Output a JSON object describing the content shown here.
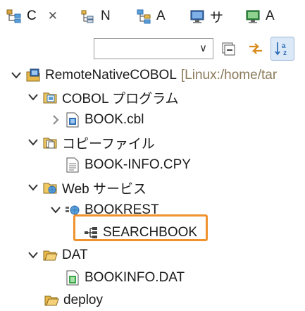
{
  "tabs": [
    {
      "label": "C",
      "icon": "cobol-explorer-icon",
      "active": true,
      "close": "✕"
    },
    {
      "label": "N",
      "icon": "navigator-icon",
      "active": false
    },
    {
      "label": "A",
      "icon": "hierarchy-icon",
      "active": false
    },
    {
      "label": "サ",
      "icon": "monitor-icon",
      "active": false
    },
    {
      "label": "A",
      "icon": "terminal-monitor-icon",
      "active": false
    }
  ],
  "toolbar": {
    "filter_value": "",
    "combo_arrow": "∨",
    "collapse_all": "collapse-all-icon",
    "link_with_editor": "link-editor-icon",
    "sort": "sort-az-icon",
    "sort_label": "↓a z"
  },
  "tree": {
    "project": {
      "label": "RemoteNativeCOBOL",
      "detail": "[Linux:/home/tar"
    },
    "cobol_programs": {
      "label": "COBOL プログラム"
    },
    "book_cbl": {
      "label": "BOOK.cbl"
    },
    "copy_files": {
      "label": "コピーファイル"
    },
    "book_info_cpy": {
      "label": "BOOK-INFO.CPY"
    },
    "web_services": {
      "label": "Web サービス"
    },
    "bookrest": {
      "label": "BOOKREST"
    },
    "searchbook": {
      "label": "SEARCHBOOK"
    },
    "dat": {
      "label": "DAT"
    },
    "bookinfo_dat": {
      "label": "BOOKINFO.DAT"
    },
    "deploy": {
      "label": "deploy"
    }
  },
  "colors": {
    "highlight": "#f0922e",
    "folder": "#e8b94a",
    "project_blue": "#2f6fb6"
  }
}
